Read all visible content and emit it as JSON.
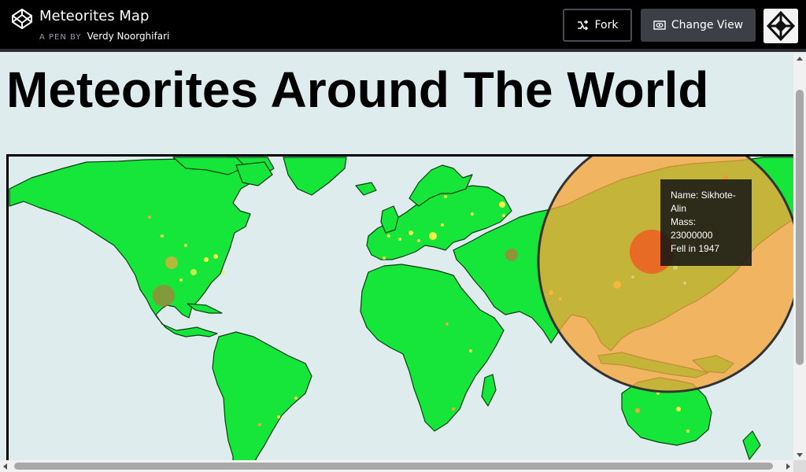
{
  "header": {
    "pen_title": "Meteorites Map",
    "byline_prefix": "A PEN BY",
    "author": "Verdy Noorghifari",
    "fork_label": "Fork",
    "change_view_label": "Change View"
  },
  "page": {
    "title": "Meteorites Around The World"
  },
  "tooltip": {
    "name": "Name: Sikhote-Alin",
    "mass_label": "Mass:",
    "mass_value": "23000000",
    "fell": "Fell in 1947"
  },
  "colors": {
    "land": "#16e63a",
    "ocean": "#dfeced",
    "meteorite_large": "#f6a53a",
    "meteorite_small": "#f2f247",
    "tooltip_bg": "#141414"
  },
  "icons": {
    "codepen_logo": "codepen-logo-icon",
    "fork": "fork-icon",
    "change_view": "eye-icon"
  }
}
